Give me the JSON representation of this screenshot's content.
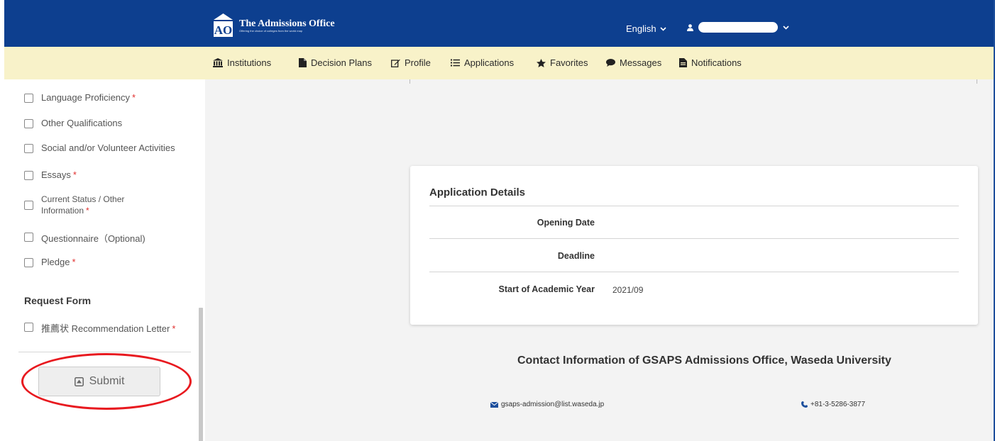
{
  "header": {
    "logo_title": "The Admissions Office",
    "logo_tagline": "Offering the choice of colleges from the world map",
    "language": "English",
    "colors": {
      "topbar": "#0d3f8f",
      "navbar": "#f8f2c9"
    }
  },
  "nav": [
    {
      "label": "Institutions",
      "icon": "institution-icon"
    },
    {
      "label": "Decision Plans",
      "icon": "document-icon"
    },
    {
      "label": "Profile",
      "icon": "edit-icon"
    },
    {
      "label": "Applications",
      "icon": "list-icon"
    },
    {
      "label": "Favorites",
      "icon": "star-icon"
    },
    {
      "label": "Messages",
      "icon": "chat-icon"
    },
    {
      "label": "Notifications",
      "icon": "notification-icon"
    }
  ],
  "sidebar": {
    "items": [
      {
        "label": "Language Proficiency",
        "required": "*"
      },
      {
        "label": "Other Qualifications",
        "required": ""
      },
      {
        "label": "Social and/or Volunteer Activities",
        "required": ""
      },
      {
        "label": "Essays",
        "required": "*"
      },
      {
        "label_line1": "Current Status / Other",
        "label_line2": "Information",
        "required": "*"
      },
      {
        "label": "Questionnaire（Optional)",
        "required": ""
      },
      {
        "label": "Pledge",
        "required": "*"
      }
    ],
    "request_heading": "Request Form",
    "request_items": [
      {
        "label": "推薦状 Recommendation Letter",
        "required": "*"
      }
    ],
    "submit_label": "Submit"
  },
  "details": {
    "title": "Application Details",
    "rows": [
      {
        "label": "Opening Date",
        "value": ""
      },
      {
        "label": "Deadline",
        "value": ""
      },
      {
        "label": "Start of Academic Year",
        "value": "2021/09"
      }
    ]
  },
  "contact": {
    "title": "Contact Information of GSAPS Admissions Office, Waseda University",
    "email": "gsaps-admission@list.waseda.jp",
    "phone": "+81-3-5286-3877"
  },
  "annotation_color": "#e8191f"
}
